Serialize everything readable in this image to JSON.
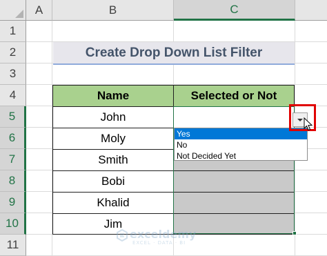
{
  "columns": [
    "A",
    "B",
    "C"
  ],
  "rows": [
    "1",
    "2",
    "3",
    "4",
    "5",
    "6",
    "7",
    "8",
    "9",
    "10",
    "11"
  ],
  "title": "Create Drop Down List Filter",
  "table": {
    "headers": [
      "Name",
      "Selected or Not"
    ],
    "names": [
      "John",
      "Moly",
      "Smith",
      "Bobi",
      "Khalid",
      "Jim"
    ]
  },
  "dropdown": {
    "options": [
      "Yes",
      "No",
      "Not Decided Yet"
    ],
    "selected": "Yes"
  },
  "watermark": {
    "name": "exceldemy",
    "tagline": "EXCEL · DATA · BI"
  },
  "colors": {
    "header_fill": "#a9d18e",
    "title_fill": "#e7e6ec",
    "selection": "#217346",
    "highlight": "#e00000",
    "option_selected": "#0078d7",
    "disabled_cells": "#c9c9c9"
  }
}
